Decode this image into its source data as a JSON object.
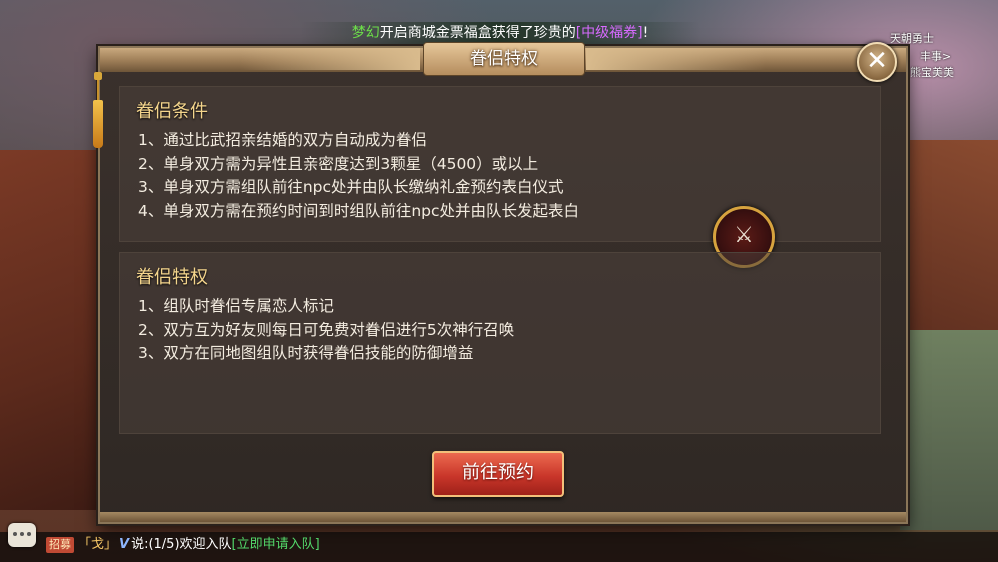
{
  "broadcast": {
    "player": "梦幻",
    "text": "开启商城金票福盒获得了珍贵的",
    "item": "[中级福券]",
    "end": "!"
  },
  "scene_labels": [
    {
      "text": "天朝勇士"
    },
    {
      "text": "丰事>"
    },
    {
      "text": "熊宝美美"
    }
  ],
  "dialog": {
    "title": "眷侣特权",
    "close_glyph": "✕",
    "conditions": {
      "heading": "眷侣条件",
      "lines": [
        "1、通过比武招亲结婚的双方自动成为眷侣",
        "2、单身双方需为异性且亲密度达到3颗星（4500）或以上",
        "3、单身双方需组队前往npc处并由队长缴纳礼金预约表白仪式",
        "4、单身双方需在预约时间到时组队前往npc处并由队长发起表白"
      ]
    },
    "privileges": {
      "heading": "眷侣特权",
      "lines": [
        "1、组队时眷侣专属恋人标记",
        "2、双方互为好友则每日可免费对眷侣进行5次神行召唤",
        "3、双方在同地图组队时获得眷侣技能的防御增益"
      ]
    },
    "emblem_glyph": "⚔",
    "action_label": "前往预约"
  },
  "chat": {
    "tag": "招募",
    "name": "「戈」",
    "v_badge": "V",
    "said": "说:(1/5)欢迎入队",
    "link": "[立即申请入队]"
  },
  "icons": {
    "close": "close-icon",
    "emblem": "crossed-swords-icon",
    "chat": "chat-bubble-icon"
  }
}
